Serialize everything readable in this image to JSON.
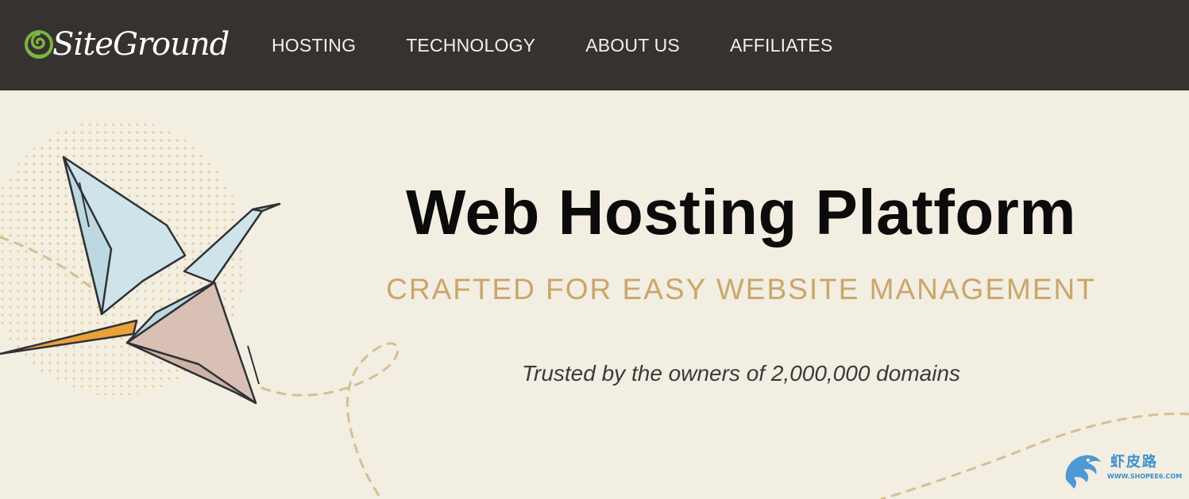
{
  "header": {
    "logo_text": "SiteGround",
    "nav": [
      {
        "label": "HOSTING"
      },
      {
        "label": "TECHNOLOGY"
      },
      {
        "label": "ABOUT US"
      },
      {
        "label": "AFFILIATES"
      }
    ]
  },
  "hero": {
    "title": "Web Hosting Platform",
    "subtitle": "CRAFTED FOR EASY WEBSITE MANAGEMENT",
    "trusted": "Trusted by the owners of 2,000,000 domains"
  },
  "watermark": {
    "cn_text": "虾皮路",
    "url": "WWW.SHOPEE6.COM"
  },
  "colors": {
    "header_bg": "#363230",
    "hero_bg": "#f2eee1",
    "accent_gold": "#c9a66b",
    "logo_green": "#7cb342",
    "title_text": "#0b0b0b"
  },
  "icons": {
    "logo": "siteground-spiral-icon",
    "hero_illustration": "origami-crane-icon",
    "watermark": "dragon-icon"
  }
}
